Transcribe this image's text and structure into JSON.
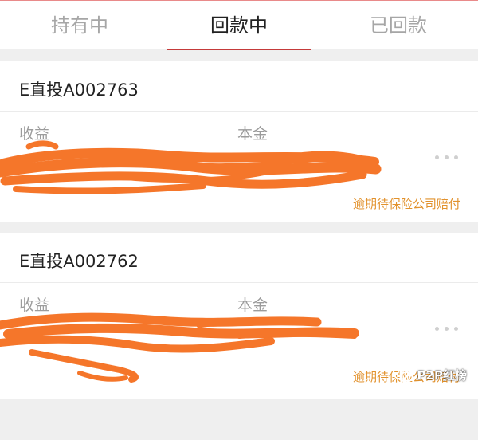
{
  "tabs": [
    {
      "label": "持有中",
      "active": false
    },
    {
      "label": "回款中",
      "active": true
    },
    {
      "label": "已回款",
      "active": false
    }
  ],
  "colors": {
    "accent": "#c53a3a",
    "status": "#e2922d",
    "redaction": "#f5762a"
  },
  "cards": [
    {
      "title": "E直投A002763",
      "income_label": "收益",
      "principal_label": "本金",
      "more_icon": "ellipsis-icon",
      "status": "逾期待保险公司赔付"
    },
    {
      "title": "E直投A002762",
      "income_label": "收益",
      "principal_label": "本金",
      "more_icon": "ellipsis-icon",
      "status": "逾期待保险公司赔付"
    }
  ],
  "watermark": {
    "text": "P2P红榜"
  }
}
